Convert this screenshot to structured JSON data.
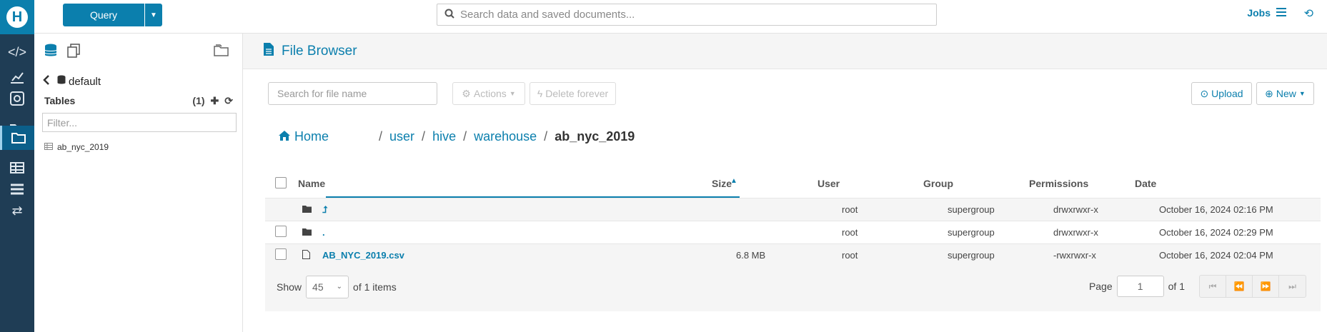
{
  "rail": {
    "logo": "H",
    "items": [
      {
        "icon": "code-icon",
        "glyph": "</>"
      },
      {
        "icon": "chart-icon",
        "glyph": "📈"
      },
      {
        "icon": "target-icon",
        "glyph": "◎"
      },
      {
        "icon": "folder-open-icon",
        "glyph": "🗁"
      },
      {
        "icon": "folder-icon",
        "glyph": "🗀",
        "active": true
      },
      {
        "icon": "table-icon",
        "glyph": "▦"
      },
      {
        "icon": "server-icon",
        "glyph": "☰"
      },
      {
        "icon": "transfer-icon",
        "glyph": "⇄"
      }
    ]
  },
  "topbar": {
    "query_label": "Query",
    "search_placeholder": "Search data and saved documents...",
    "jobs_label": "Jobs"
  },
  "left_panel": {
    "database": "default",
    "tables_label": "Tables",
    "tables_count": "(1)",
    "filter_placeholder": "Filter...",
    "tables": [
      "ab_nyc_2019"
    ]
  },
  "file_browser": {
    "title": "File Browser",
    "search_placeholder": "Search for file name",
    "actions_label": "Actions",
    "delete_label": "Delete forever",
    "upload_label": "Upload",
    "new_label": "New",
    "breadcrumb": {
      "home": "Home",
      "parts": [
        "user",
        "hive",
        "warehouse"
      ],
      "current": "ab_nyc_2019"
    },
    "columns": {
      "name": "Name",
      "size": "Size",
      "user": "User",
      "group": "Group",
      "permissions": "Permissions",
      "date": "Date"
    },
    "rows": [
      {
        "type": "folder",
        "name": "⮥",
        "size": "",
        "user": "root",
        "group": "supergroup",
        "permissions": "drwxrwxr-x",
        "date": "October 16, 2024 02:16 PM",
        "checkbox": false
      },
      {
        "type": "folder",
        "name": ".",
        "size": "",
        "user": "root",
        "group": "supergroup",
        "permissions": "drwxrwxr-x",
        "date": "October 16, 2024 02:29 PM",
        "checkbox": true
      },
      {
        "type": "file",
        "name": "AB_NYC_2019.csv",
        "size": "6.8 MB",
        "user": "root",
        "group": "supergroup",
        "permissions": "-rwxrwxr-x",
        "date": "October 16, 2024 02:04 PM",
        "checkbox": true
      }
    ],
    "footer": {
      "show_label": "Show",
      "page_size": "45",
      "of_items": "of 1 items",
      "page_label": "Page",
      "page_value": "1",
      "of_pages": "of 1"
    }
  },
  "colors": {
    "accent": "#0b7fad",
    "rail_bg": "#1f3d55"
  }
}
